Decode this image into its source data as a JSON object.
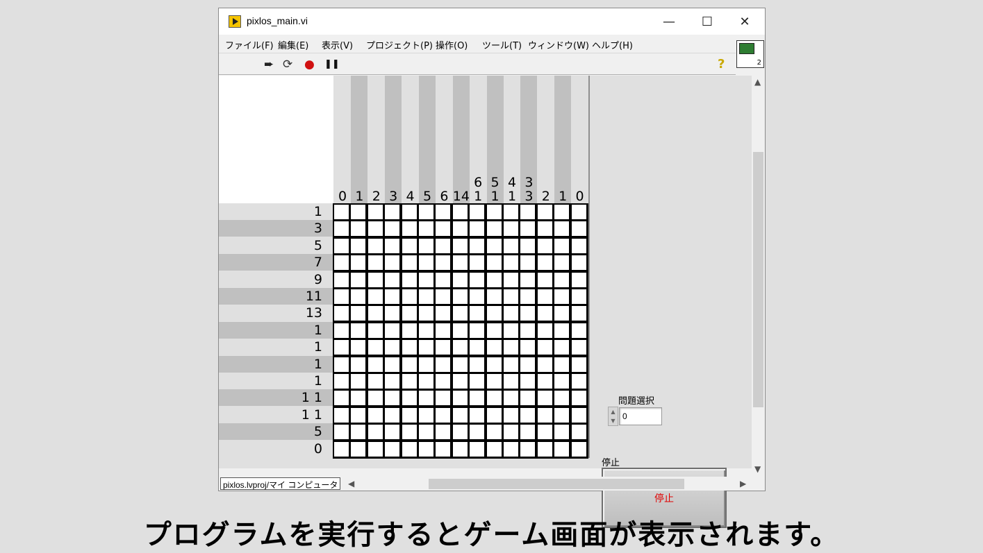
{
  "window": {
    "title": "pixlos_main.vi",
    "minimize": "—",
    "maximize": "☐",
    "close": "✕"
  },
  "menu": [
    {
      "label": "ファイル(F)"
    },
    {
      "label": "編集(E)"
    },
    {
      "label": "表示(V)"
    },
    {
      "label": "プロジェクト(P)"
    },
    {
      "label": "操作(O)"
    },
    {
      "label": "ツール(T)"
    },
    {
      "label": "ウィンドウ(W)"
    },
    {
      "label": "ヘルプ(H)"
    }
  ],
  "toolbar": [
    {
      "icon": "run-arrow-icon",
      "glyph": "➨"
    },
    {
      "icon": "run-continuously-icon",
      "glyph": "⟳"
    },
    {
      "icon": "abort-icon",
      "glyph": "●"
    },
    {
      "icon": "pause-icon",
      "glyph": "❚❚"
    }
  ],
  "help_glyph": "?",
  "vi_icon_number": "2",
  "puzzle": {
    "column_clues": [
      [
        "0"
      ],
      [
        "1"
      ],
      [
        "2"
      ],
      [
        "3"
      ],
      [
        "4"
      ],
      [
        "5"
      ],
      [
        "6"
      ],
      [
        "14"
      ],
      [
        "6",
        "1"
      ],
      [
        "5",
        "1"
      ],
      [
        "4",
        "1"
      ],
      [
        "3",
        "3"
      ],
      [
        "2"
      ],
      [
        "1"
      ],
      [
        "0"
      ]
    ],
    "row_clues": [
      "1",
      "3",
      "5",
      "7",
      "9",
      "11",
      "13",
      "1",
      "1",
      "1",
      "1",
      "1 1",
      "1 1",
      "5",
      "0"
    ]
  },
  "problem_select": {
    "label": "問題選択",
    "value": "0"
  },
  "stop": {
    "label": "停止",
    "button_text": "停止"
  },
  "status": {
    "path": "pixlos.lvproj/マイ コンピュータ"
  },
  "caption": "プログラムを実行するとゲーム画面が表示されます。",
  "colors": {
    "stripe_dark": "#c0c0c0",
    "stripe_light": "#e0e0e0",
    "stop_text": "#e00000",
    "panel_bg": "#e0e0e0"
  }
}
